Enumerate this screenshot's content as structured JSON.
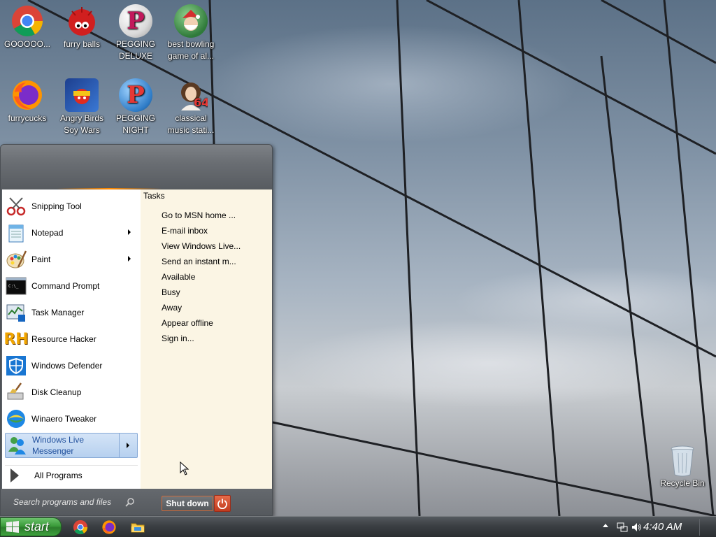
{
  "desktop": {
    "icons": [
      {
        "label": "GOOOOO..."
      },
      {
        "label": "furry balls"
      },
      {
        "label": "PEGGING DELUXE"
      },
      {
        "label": "best bowling game of al..."
      },
      {
        "label": "furrycucks"
      },
      {
        "label": "Angry Birds Soy Wars"
      },
      {
        "label": "PEGGING NIGHT"
      },
      {
        "label": "classical music stati..."
      }
    ],
    "recycle_bin": {
      "label": "Recycle Bin"
    }
  },
  "start_menu": {
    "programs": [
      {
        "label": "Snipping Tool",
        "icon": "snipping-tool-icon",
        "submenu": false
      },
      {
        "label": "Notepad",
        "icon": "notepad-icon",
        "submenu": true
      },
      {
        "label": "Paint",
        "icon": "paint-icon",
        "submenu": true
      },
      {
        "label": "Command Prompt",
        "icon": "command-prompt-icon",
        "submenu": false
      },
      {
        "label": "Task Manager",
        "icon": "task-manager-icon",
        "submenu": false
      },
      {
        "label": "Resource Hacker",
        "icon": "resource-hacker-icon",
        "submenu": false
      },
      {
        "label": "Windows Defender",
        "icon": "windows-defender-icon",
        "submenu": false
      },
      {
        "label": "Disk Cleanup",
        "icon": "disk-cleanup-icon",
        "submenu": false
      },
      {
        "label": "Winaero Tweaker",
        "icon": "winaero-tweaker-icon",
        "submenu": false
      },
      {
        "label": "Windows Live Messenger",
        "icon": "messenger-icon",
        "submenu": true,
        "selected": true
      }
    ],
    "all_programs": "All Programs",
    "tasks": {
      "title": "Tasks",
      "items": [
        "Go to MSN home ...",
        "E-mail inbox",
        "View Windows Live...",
        "Send an instant m...",
        "Available",
        "Busy",
        "Away",
        "Appear offline",
        "Sign in..."
      ]
    },
    "search_placeholder": "Search programs and files",
    "shutdown_label": "Shut down"
  },
  "taskbar": {
    "start_label": "start",
    "pinned": [
      "chrome-icon",
      "firefox-icon",
      "file-explorer-icon"
    ],
    "clock": "4:40 AM"
  },
  "colors": {
    "start_green": "#3a9b3a",
    "menu_selected": "#b6d0ef",
    "tasks_bg": "#fbf5e4",
    "shutdown_red": "#c13b1e"
  }
}
